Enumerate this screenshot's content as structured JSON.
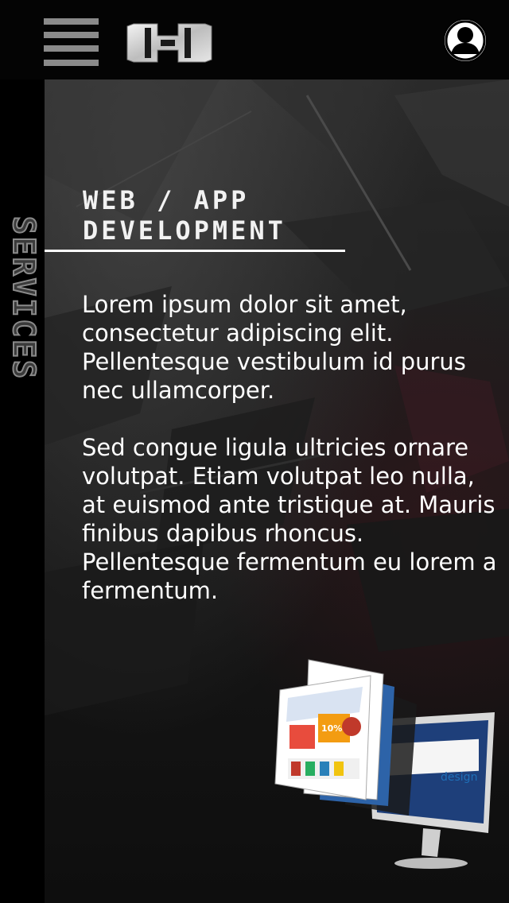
{
  "header": {
    "menu_icon": "hamburger-menu-icon",
    "logo_icon": "h-logo-icon",
    "profile_icon": "user-avatar-icon"
  },
  "sidebar": {
    "label": "SERVICES"
  },
  "main": {
    "title": "WEB / APP DEVELOPMENT",
    "paragraphs": [
      "Lorem ipsum dolor sit amet, consectetur adipiscing elit. Pellentesque vestibulum id purus nec ullamcorper.",
      "Sed congue ligula ultricies ornare volutpat. Etiam volutpat leo nulla, at euismod ante tristique at. Mauris finibus dapibus rhoncus. Pellentesque fermentum eu lorem a fermentum."
    ],
    "illustration_icon": "devices-illustration"
  },
  "colors": {
    "background": "#000000",
    "panel": "#1c1c1c",
    "text": "#ffffff",
    "accent_gray": "#8a8a8a"
  }
}
